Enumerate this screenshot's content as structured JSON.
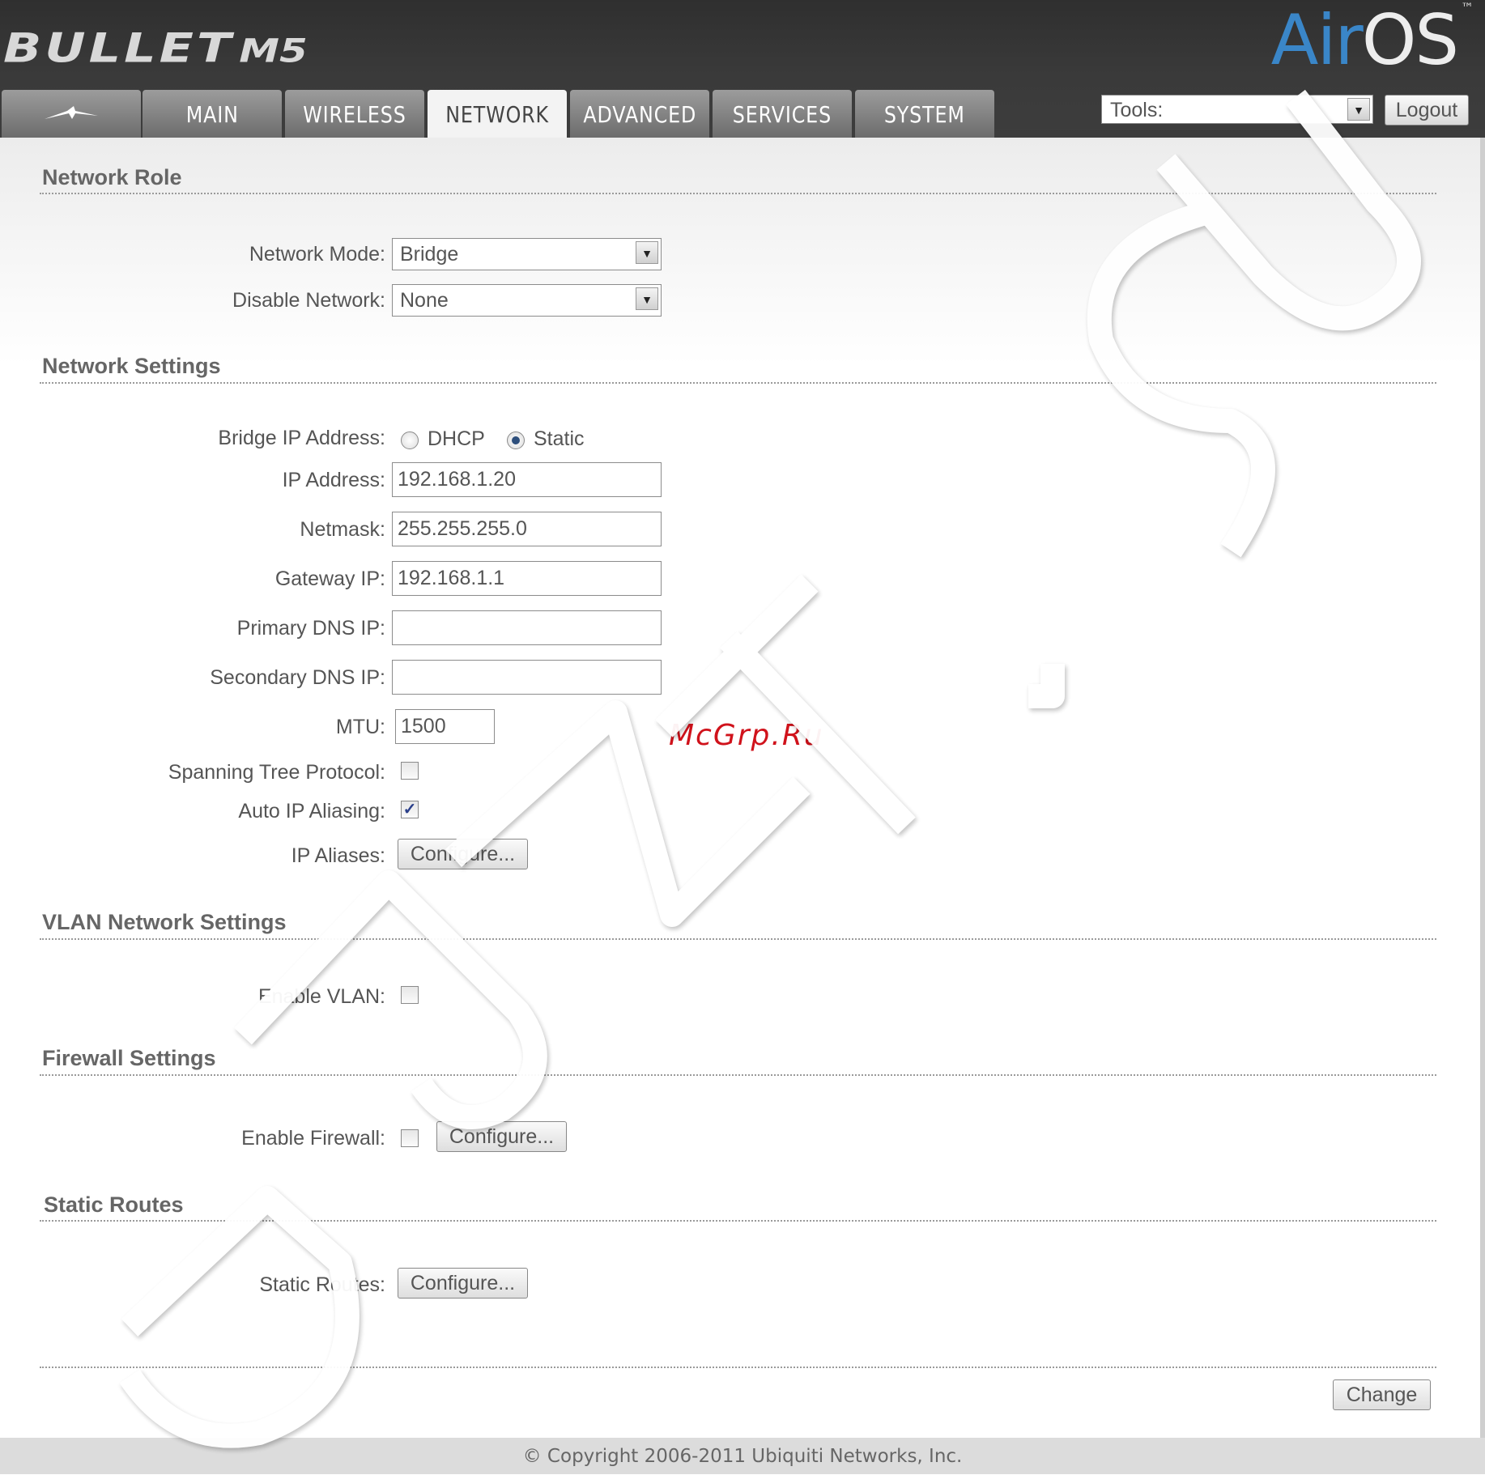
{
  "header": {
    "brand": "BULLET",
    "model": "M5",
    "product_logo": {
      "air": "Air",
      "os": "OS",
      "tm": "™"
    }
  },
  "tabs": [
    {
      "label": "",
      "icon": "ubiquiti-logo-icon"
    },
    {
      "label": "MAIN"
    },
    {
      "label": "WIRELESS"
    },
    {
      "label": "NETWORK",
      "active": true
    },
    {
      "label": "ADVANCED"
    },
    {
      "label": "SERVICES"
    },
    {
      "label": "SYSTEM"
    }
  ],
  "toolbar": {
    "tools_label": "Tools:",
    "logout_label": "Logout"
  },
  "network_role": {
    "title": "Network Role",
    "network_mode_label": "Network Mode:",
    "network_mode_value": "Bridge",
    "disable_network_label": "Disable Network:",
    "disable_network_value": "None"
  },
  "network_settings": {
    "title": "Network Settings",
    "bridge_ip_label": "Bridge IP Address:",
    "dhcp_label": "DHCP",
    "static_label": "Static",
    "bridge_ip_mode": "Static",
    "ip_label": "IP Address:",
    "ip_value": "192.168.1.20",
    "netmask_label": "Netmask:",
    "netmask_value": "255.255.255.0",
    "gateway_label": "Gateway IP:",
    "gateway_value": "192.168.1.1",
    "primary_dns_label": "Primary DNS IP:",
    "primary_dns_value": "",
    "secondary_dns_label": "Secondary DNS IP:",
    "secondary_dns_value": "",
    "mtu_label": "MTU:",
    "mtu_value": "1500",
    "stp_label": "Spanning Tree Protocol:",
    "stp_checked": false,
    "auto_alias_label": "Auto IP Aliasing:",
    "auto_alias_checked": true,
    "ip_aliases_label": "IP Aliases:",
    "configure_label": "Configure..."
  },
  "vlan": {
    "title": "VLAN Network Settings",
    "enable_label": "Enable VLAN:",
    "enabled": false
  },
  "firewall": {
    "title": "Firewall Settings",
    "enable_label": "Enable Firewall:",
    "enabled": false,
    "configure_label": "Configure..."
  },
  "static_routes": {
    "title": "Static Routes",
    "label": "Static Routes:",
    "configure_label": "Configure..."
  },
  "actions": {
    "change_label": "Change"
  },
  "footer": {
    "copyright": "© Copyright 2006-2011 Ubiquiti Networks, Inc."
  },
  "watermarks": {
    "site": "McGrp.Ru",
    "overlay": "UBNT.SU"
  },
  "colors": {
    "accent_blue": "#3a86c8",
    "header_bg": "#333333",
    "watermark_red": "#d0121b"
  }
}
